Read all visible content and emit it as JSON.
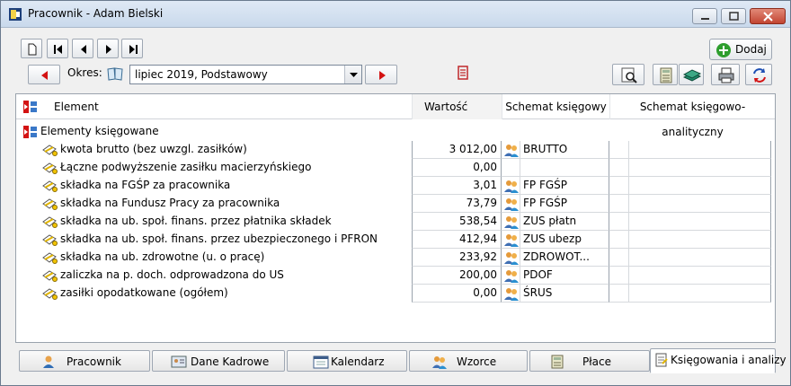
{
  "window": {
    "title": "Pracownik - Adam Bielski"
  },
  "toolbar": {
    "add_label": "Dodaj",
    "period_label": "Okres:",
    "period_value": "lipiec 2019, Podstawowy"
  },
  "grid": {
    "columns": [
      "Element",
      "Wartość",
      "Schemat księgowy",
      "Schemat księgowo-analityczny"
    ],
    "group_label": "Elementy księgowane",
    "rows": [
      {
        "name": "kwota brutto (bez uwzgl. zasiłków)",
        "value": "3 012,00",
        "scheme": "BRUTTO",
        "has_scheme_icon": true
      },
      {
        "name": "Łączne podwyższenie zasiłku macierzyńskiego",
        "value": "0,00",
        "scheme": "",
        "has_scheme_icon": false
      },
      {
        "name": "składka na FGŚP za pracownika",
        "value": "3,01",
        "scheme": "FP FGŚP",
        "has_scheme_icon": true
      },
      {
        "name": "składka na Fundusz Pracy za pracownika",
        "value": "73,79",
        "scheme": "FP FGŚP",
        "has_scheme_icon": true
      },
      {
        "name": "składka na ub. społ. finans. przez płatnika składek",
        "value": "538,54",
        "scheme": "ZUS płatn",
        "has_scheme_icon": true
      },
      {
        "name": "składka na ub. społ. finans. przez ubezpieczonego i PFRON",
        "value": "412,94",
        "scheme": "ZUS ubezp",
        "has_scheme_icon": true
      },
      {
        "name": "składka na ub. zdrowotne (u. o pracę)",
        "value": "233,92",
        "scheme": "ZDROWOT...",
        "has_scheme_icon": true
      },
      {
        "name": "zaliczka na p. doch. odprowadzona do US",
        "value": "200,00",
        "scheme": "PDOF",
        "has_scheme_icon": true
      },
      {
        "name": "zasiłki opodatkowane (ogółem)",
        "value": "0,00",
        "scheme": "ŚRUS",
        "has_scheme_icon": true
      }
    ]
  },
  "tabs": [
    {
      "label": "Pracownik",
      "icon": "person-icon",
      "active": false
    },
    {
      "label": "Dane Kadrowe",
      "icon": "id-card-icon",
      "active": false
    },
    {
      "label": "Kalendarz",
      "icon": "calendar-icon",
      "active": false
    },
    {
      "label": "Wzorce",
      "icon": "people-icon",
      "active": false
    },
    {
      "label": "Płace",
      "icon": "calculator-icon",
      "active": false
    },
    {
      "label": "Księgowania i analizy",
      "icon": "ledger-icon",
      "active": true
    }
  ],
  "colors": {
    "accent_red": "#d31212",
    "add_green": "#2e9e2e"
  }
}
